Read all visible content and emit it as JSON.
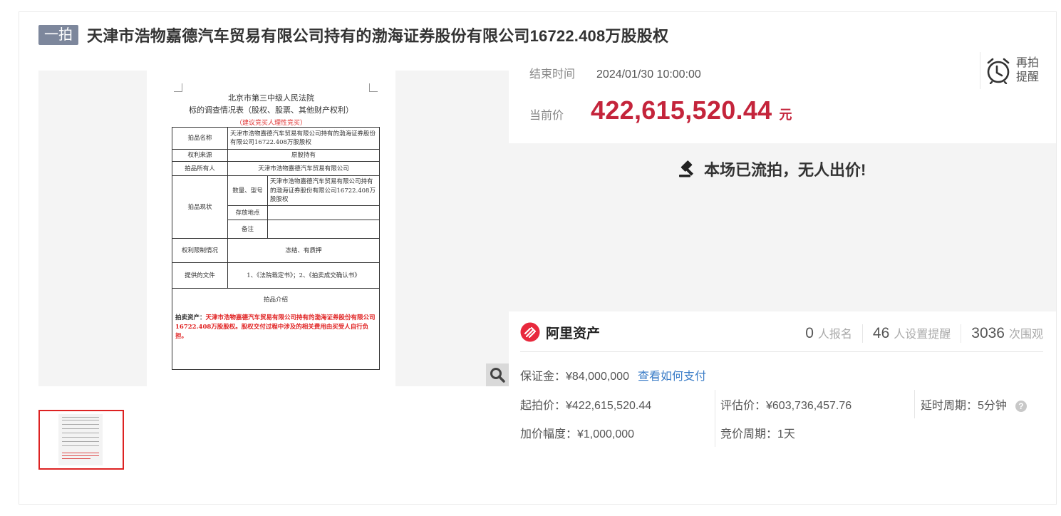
{
  "header": {
    "tag": "一拍",
    "title": "天津市浩物嘉德汽车贸易有限公司持有的渤海证券股份有限公司16722.408万股股权"
  },
  "document": {
    "court": "北京市第三中级人民法院",
    "form_title": "标的调查情况表（股权、股票、其他财产权利）",
    "notice": "（建议竞买人理性竞买）",
    "rows": {
      "item_name_label": "拍品名称",
      "item_name_value": "天津市浩物嘉德汽车贸易有限公司持有的渤海证券股份有限公司16722.408万股股权",
      "rights_source_label": "权利来源",
      "rights_source_value": "原股持有",
      "owner_label": "拍品所有人",
      "owner_value": "天津市浩物嘉德汽车贸易有限公司",
      "status_label": "拍品现状",
      "quantity_label": "数量、型号",
      "quantity_value": "天津市浩物嘉德汽车贸易有限公司持有的渤海证券股份有限公司16722.408万股股权",
      "location_label": "存放地点",
      "note_label": "备注",
      "restriction_label": "权利限制情况",
      "restriction_value": "冻结、有质押",
      "docs_label": "提供的文件",
      "docs_value": "1、《法院裁定书》；2、《拍卖成交确认书》",
      "intro_title": "拍品介绍",
      "intro_lead": "拍卖资产：",
      "intro_body": "天津市浩物嘉德汽车贸易有限公司持有的渤海证券股份有限公司16722.408万股股权。股权交付过程中涉及的相关费用由买受人自行负担。"
    }
  },
  "auction": {
    "end_label": "结束时间",
    "end_value": "2024/01/30 10:00:00",
    "remind_line1": "再拍",
    "remind_line2": "提醒",
    "price_label": "当前价",
    "price_value": "422,615,520.44",
    "price_unit": "元",
    "status_text": "本场已流拍，无人出价!"
  },
  "platform": {
    "name": "阿里资产",
    "signups": "0",
    "signups_label": "人报名",
    "reminders": "46",
    "reminders_label": "人设置提醒",
    "views": "3036",
    "views_label": "次围观"
  },
  "details": {
    "deposit": "保证金：¥84,000,000",
    "deposit_link": "查看如何支付",
    "start_price": "起拍价：¥422,615,520.44",
    "appraisal": "评估价：¥603,736,457.76",
    "delay": "延时周期：5分钟",
    "increment": "加价幅度：¥1,000,000",
    "bid_period": "竞价周期：1天"
  },
  "colors": {
    "price_red": "#c4243b",
    "tag_gray": "#7d879c",
    "link_blue": "#3a7cc7",
    "ali_red": "#e8293d"
  }
}
